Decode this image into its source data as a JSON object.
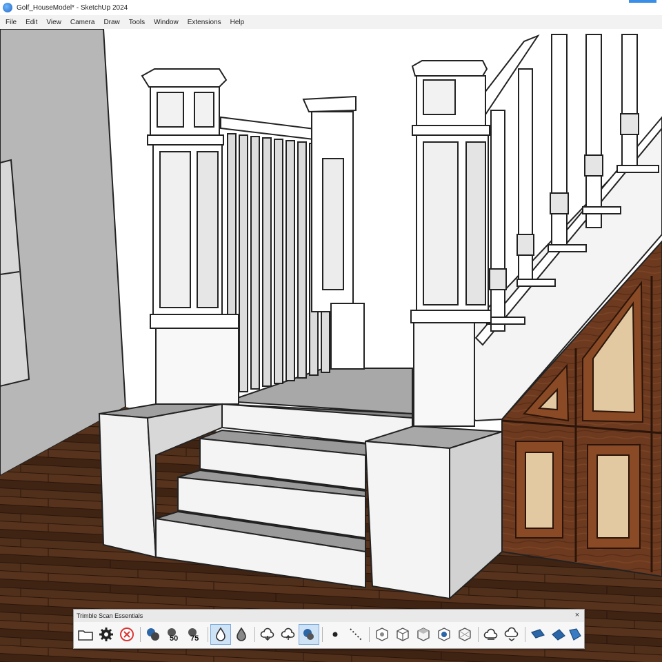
{
  "window": {
    "title": "Golf_HouseModel* - SketchUp 2024"
  },
  "menu": [
    "File",
    "Edit",
    "View",
    "Camera",
    "Draw",
    "Tools",
    "Window",
    "Extensions",
    "Help"
  ],
  "toolbar": {
    "title": "Trimble Scan Essentials",
    "close_glyph": "×",
    "buttons": [
      {
        "name": "open-folder-icon"
      },
      {
        "name": "gear-icon"
      },
      {
        "name": "cancel-icon"
      },
      {
        "name": "layers-icon"
      },
      {
        "name": "layers-50-icon",
        "label": "50"
      },
      {
        "name": "layers-75-icon",
        "label": "75"
      },
      {
        "name": "droplet-active-icon"
      },
      {
        "name": "droplet-icon"
      },
      {
        "name": "cloud-down-icon"
      },
      {
        "name": "cloud-up-icon"
      },
      {
        "name": "cloud-layers-icon"
      },
      {
        "name": "point-icon"
      },
      {
        "name": "dotted-line-icon"
      },
      {
        "name": "cube-view-icon"
      },
      {
        "name": "cube-outline-icon"
      },
      {
        "name": "cube-top-icon"
      },
      {
        "name": "cube-blue-icon"
      },
      {
        "name": "cube-wire-icon"
      },
      {
        "name": "cloud-a-icon"
      },
      {
        "name": "cloud-b-icon"
      },
      {
        "name": "plane-a-icon"
      },
      {
        "name": "plane-b-icon"
      },
      {
        "name": "plane-c-icon"
      }
    ]
  }
}
